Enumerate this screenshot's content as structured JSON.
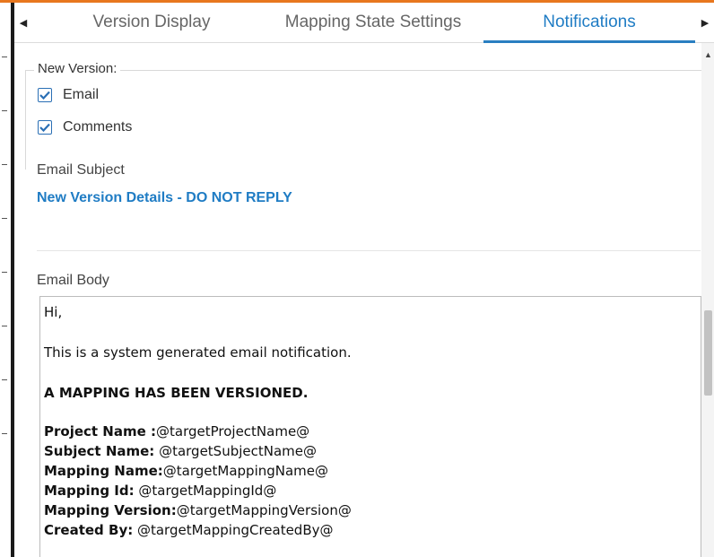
{
  "tabs": {
    "scroll_left": "◀",
    "scroll_right": "▶",
    "items": [
      {
        "label": "Version Display"
      },
      {
        "label": "Mapping State Settings"
      },
      {
        "label": "Notifications",
        "active": true
      }
    ]
  },
  "new_version": {
    "legend": "New Version:",
    "options": [
      {
        "label": "Email",
        "checked": true
      },
      {
        "label": "Comments",
        "checked": true
      }
    ]
  },
  "email_subject": {
    "label": "Email Subject",
    "value": "New Version Details - DO NOT REPLY"
  },
  "email_body": {
    "label": "Email Body",
    "greeting": "Hi,",
    "intro": "This is a system generated email notification.",
    "headline": "A MAPPING HAS BEEN VERSIONED.",
    "fields": [
      {
        "key": "Project Name :",
        "value": "@targetProjectName@"
      },
      {
        "key": "Subject Name:",
        "value": " @targetSubjectName@"
      },
      {
        "key": "Mapping Name:",
        "value": "@targetMappingName@"
      },
      {
        "key": "Mapping Id:",
        "value": " @targetMappingId@"
      },
      {
        "key": "Mapping Version:",
        "value": "@targetMappingVersion@"
      },
      {
        "key": "Created By:",
        "value": " @targetMappingCreatedBy@"
      }
    ]
  },
  "colors": {
    "accent_orange": "#e8771e",
    "active_tab": "#1f7cc4",
    "checkbox": "#2a6fb5"
  }
}
